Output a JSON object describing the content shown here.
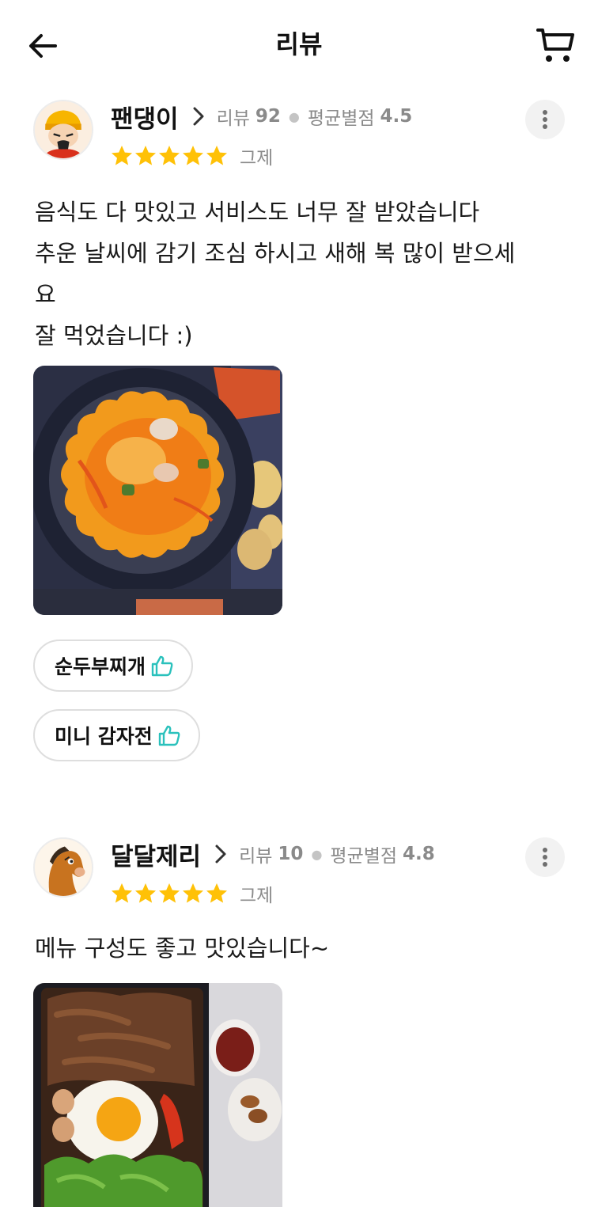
{
  "header": {
    "title": "리뷰",
    "back_icon": "arrow-left-icon",
    "cart_icon": "cart-icon"
  },
  "colors": {
    "star": "#FFC107",
    "thumb": "#2AC1BC",
    "meta_text": "#8A8A8A"
  },
  "reviews": [
    {
      "nickname": "팬댕이",
      "review_count_label": "리뷰",
      "review_count": "92",
      "avg_rating_label": "평균별점",
      "avg_rating": "4.5",
      "rating": 5,
      "menu": "그제",
      "text": "음식도 다 맛있고 서비스도 너무 잘 받았습니다\n추운 날씨에 감기 조심 하시고 새해 복 많이 받으세\n요\n잘 먹었습니다 :)",
      "liked_items": [
        "순두부찌개",
        "미니 감자전"
      ]
    },
    {
      "nickname": "달달제리",
      "review_count_label": "리뷰",
      "review_count": "10",
      "avg_rating_label": "평균별점",
      "avg_rating": "4.8",
      "rating": 5,
      "menu": "그제",
      "text": "메뉴 구성도 좋고 맛있습니다~"
    }
  ]
}
